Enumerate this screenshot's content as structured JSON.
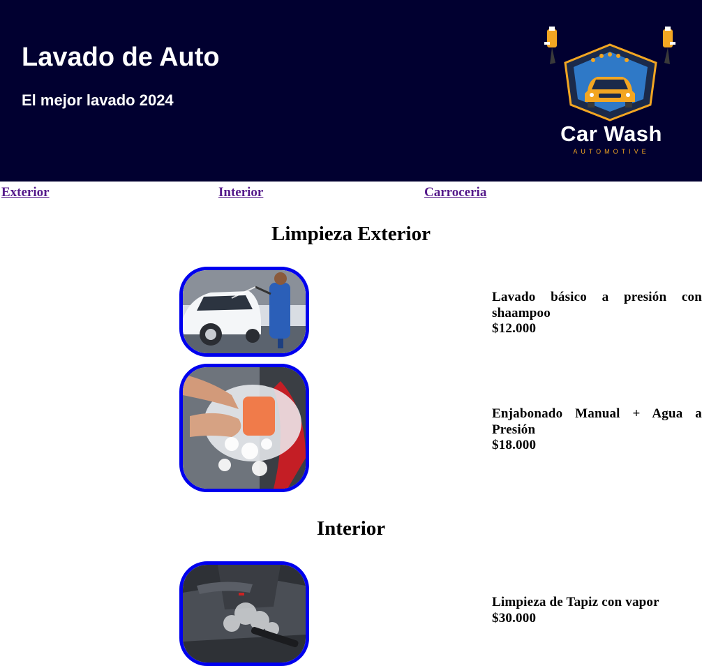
{
  "header": {
    "title": "Lavado de Auto",
    "subtitle": "El mejor lavado 2024",
    "logo": {
      "name": "Car Wash",
      "tagline": "AUTOMOTIVE"
    },
    "background": "#010030"
  },
  "nav": {
    "links": [
      {
        "label": "Exterior"
      },
      {
        "label": "Interior"
      },
      {
        "label": "Carroceria"
      }
    ],
    "link_color": "#551a8b"
  },
  "sections": [
    {
      "title": "Limpieza Exterior",
      "services": [
        {
          "name": "Lavado básico a presión con shaampoo",
          "price": "$12.000",
          "image_icon": "car-pressure-wash-photo"
        },
        {
          "name": "Enjabonado Manual + Agua a Presión",
          "price": "$18.000",
          "image_icon": "hand-sponge-soap-photo"
        }
      ]
    },
    {
      "title": "Interior",
      "services": [
        {
          "name": "Limpieza de Tapiz con vapor",
          "price": "$30.000",
          "image_icon": "seat-steam-cleaning-photo"
        }
      ]
    }
  ],
  "image_border_color": "#0000ee"
}
